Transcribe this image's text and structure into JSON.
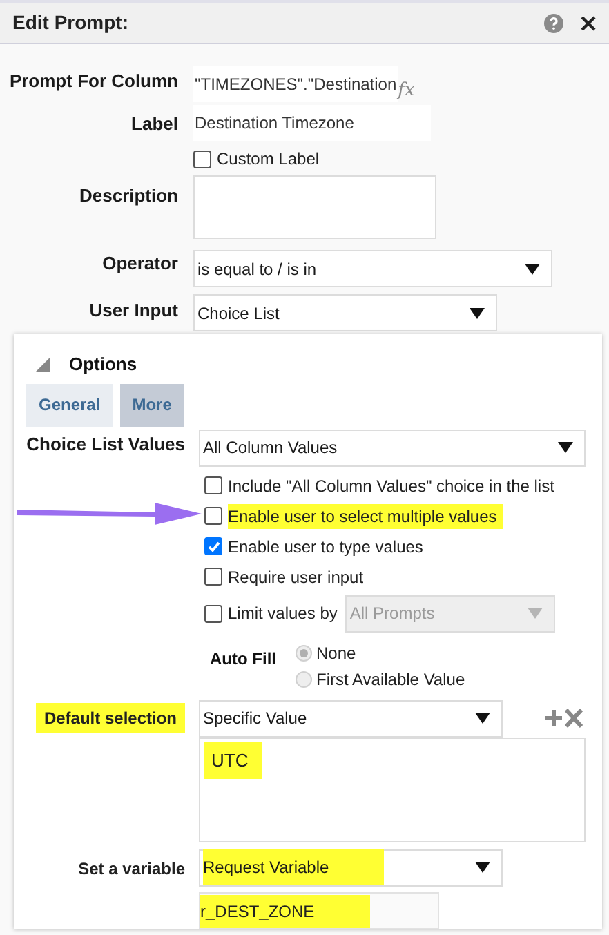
{
  "window": {
    "title": "Edit Prompt:"
  },
  "prompt_for_column": {
    "label": "Prompt For Column",
    "value": "\"TIMEZONES\".\"Destination",
    "formula_button": "fx"
  },
  "label_field": {
    "label": "Label",
    "value": "Destination Timezone"
  },
  "custom_label": {
    "label": "Custom Label",
    "checked": false
  },
  "description": {
    "label": "Description"
  },
  "operator": {
    "label": "Operator",
    "value": "is equal to / is in"
  },
  "user_input": {
    "label": "User Input",
    "value": "Choice List"
  },
  "options": {
    "title": "Options",
    "expanded": true,
    "tabs": [
      {
        "label": "General",
        "selected": false
      },
      {
        "label": "More",
        "selected": true
      }
    ],
    "choice_list_values": {
      "label": "Choice List Values",
      "value": "All Column Values"
    },
    "checkboxes": [
      {
        "label": "Include \"All Column Values\" choice in the list",
        "checked": false,
        "highlighted": false
      },
      {
        "label": "Enable user to select multiple values",
        "checked": false,
        "highlighted": true
      },
      {
        "label": "Enable user to type values",
        "checked": true,
        "highlighted": false
      },
      {
        "label": "Require user input",
        "checked": false,
        "highlighted": false
      }
    ],
    "limit_values": {
      "label": "Limit values by",
      "checked": false,
      "value": "All Prompts",
      "disabled": true
    },
    "auto_fill": {
      "label": "Auto Fill",
      "disabled": true,
      "options": [
        {
          "label": "None",
          "selected": true
        },
        {
          "label": "First Available Value",
          "selected": false
        }
      ]
    },
    "default_selection": {
      "label": "Default selection",
      "label_highlighted": true,
      "value": "Specific Value",
      "value_highlighted": false,
      "values": [
        {
          "text": "UTC",
          "highlighted": true
        }
      ]
    },
    "set_variable": {
      "label": "Set a variable",
      "label_highlighted": false,
      "value": "Request Variable",
      "value_highlighted": true,
      "name": "r_DEST_ZONE",
      "name_highlighted": true
    }
  }
}
